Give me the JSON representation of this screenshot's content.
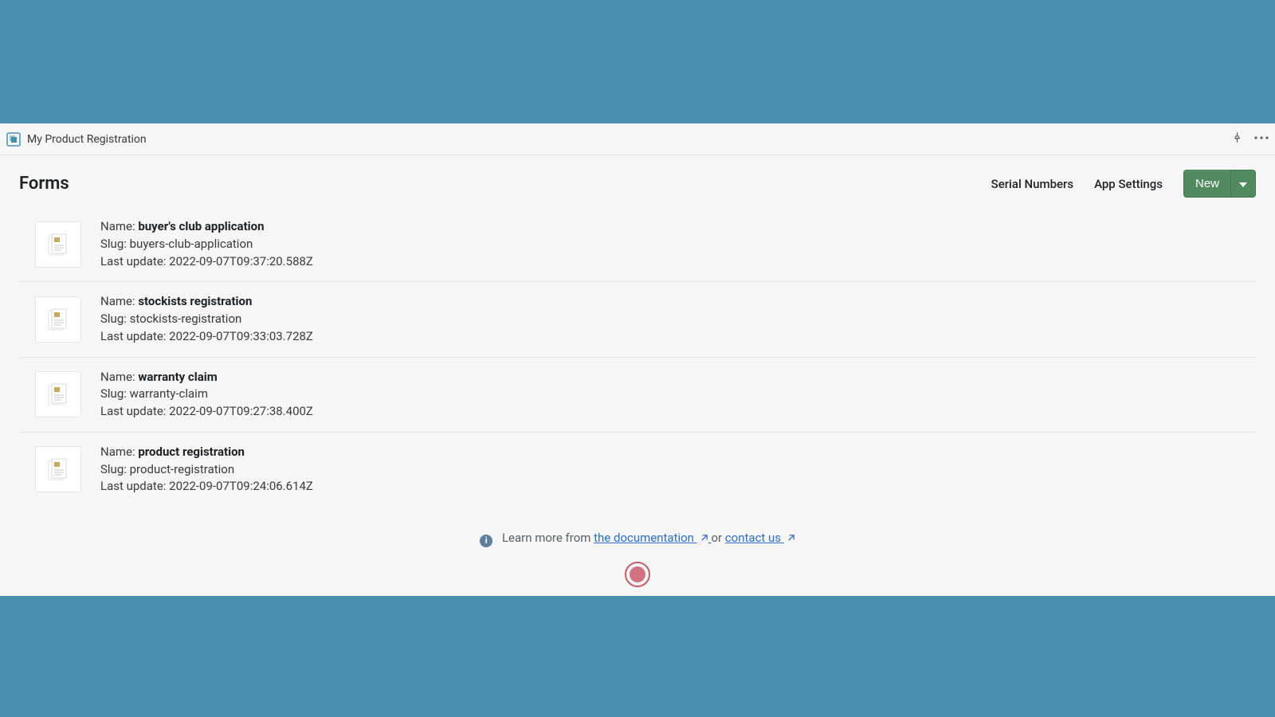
{
  "app": {
    "title": "My Product Registration"
  },
  "page": {
    "title": "Forms"
  },
  "nav": {
    "serial_numbers": "Serial Numbers",
    "app_settings": "App Settings",
    "new": "New"
  },
  "labels": {
    "name": "Name:",
    "slug": "Slug:",
    "updated": "Last update:"
  },
  "forms": [
    {
      "name": "buyer's club application",
      "slug": "buyers-club-application",
      "updated": "2022-09-07T09:37:20.588Z"
    },
    {
      "name": "stockists registration",
      "slug": "stockists-registration",
      "updated": "2022-09-07T09:33:03.728Z"
    },
    {
      "name": "warranty claim",
      "slug": "warranty-claim",
      "updated": "2022-09-07T09:27:38.400Z"
    },
    {
      "name": "product registration",
      "slug": "product-registration",
      "updated": "2022-09-07T09:24:06.614Z"
    }
  ],
  "footer": {
    "learn_prefix": "Learn more from ",
    "doc_link": "the documentation",
    "or": " or ",
    "contact_link": "contact us"
  }
}
